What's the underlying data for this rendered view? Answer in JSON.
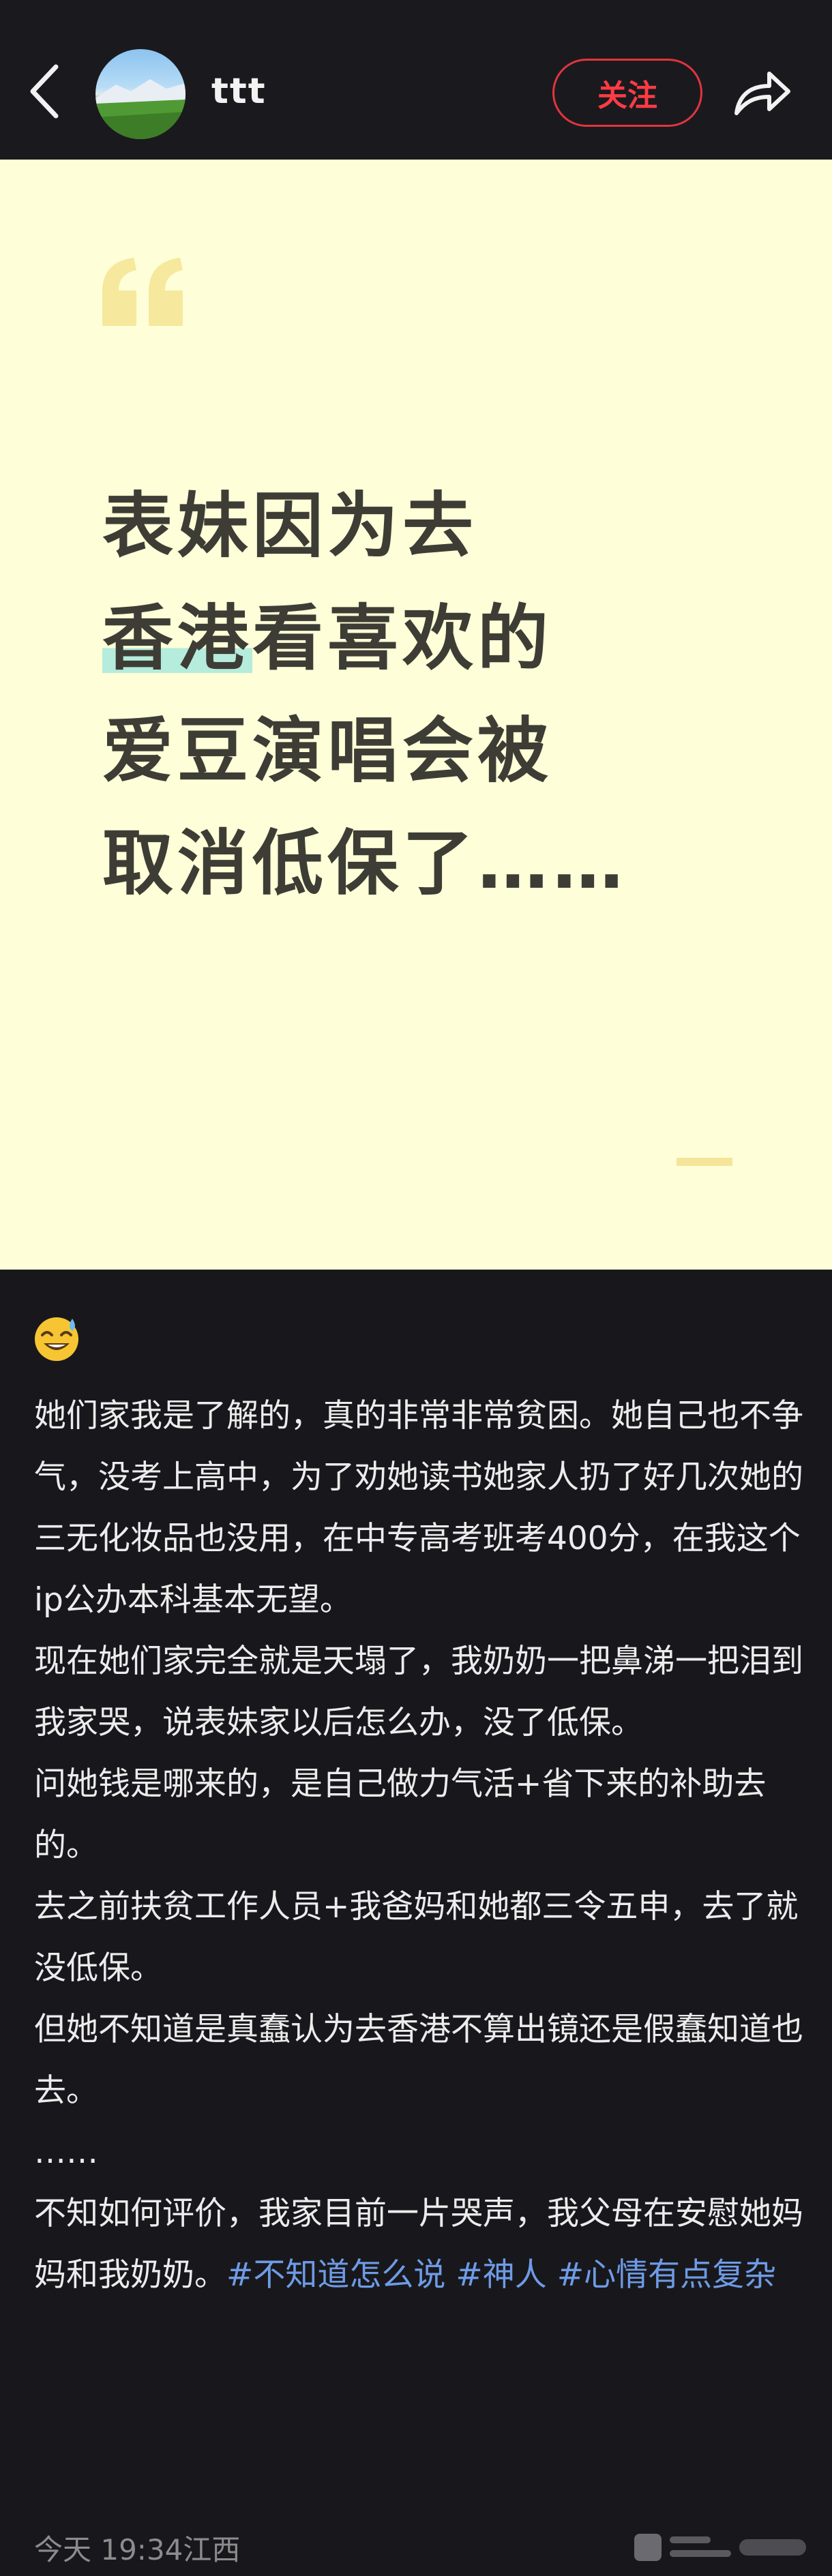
{
  "header": {
    "back_icon": "chevron-left-icon",
    "username": "ttt",
    "follow_label": "关注",
    "share_icon": "share-arrow-icon"
  },
  "quote_card": {
    "background": "#fefed8",
    "quote_icon": "open-quote-icon",
    "headline_lines": [
      "表妹因为去",
      "看喜欢的",
      "爱豆演唱会被",
      "取消低保了……"
    ],
    "headline_highlight": "香港",
    "highlight_color": "#b5ecdc"
  },
  "post": {
    "emoji": "sweat-smile-emoji",
    "paragraphs": [
      "她们家我是了解的，真的非常非常贫困。她自己也不争气，没考上高中，为了劝她读书她家人扔了好几次她的三无化妆品也没用，在中专高考班考400分，在我这个ip公办本科基本无望。",
      "现在她们家完全就是天塌了，我奶奶一把鼻涕一把泪到我家哭，说表妹家以后怎么办，没了低保。",
      "问她钱是哪来的，是自己做力气活+省下来的补助去的。",
      "去之前扶贫工作人员+我爸妈和她都三令五申，去了就没低保。",
      "但她不知道是真蠢认为去香港不算出镜还是假蠢知道也去。",
      "……"
    ],
    "last_paragraph_text": "不知如何评价，我家目前一片哭声，我父母在安慰她妈妈和我奶奶。",
    "hashtags": [
      "#不知道怎么说",
      "#神人",
      "#心情有点复杂"
    ],
    "timestamp": "今天 19:34",
    "location": "江西"
  },
  "colors": {
    "accent_red": "#e2343d",
    "hashtag_blue": "#6f9be6",
    "page_bg": "#18181c"
  }
}
